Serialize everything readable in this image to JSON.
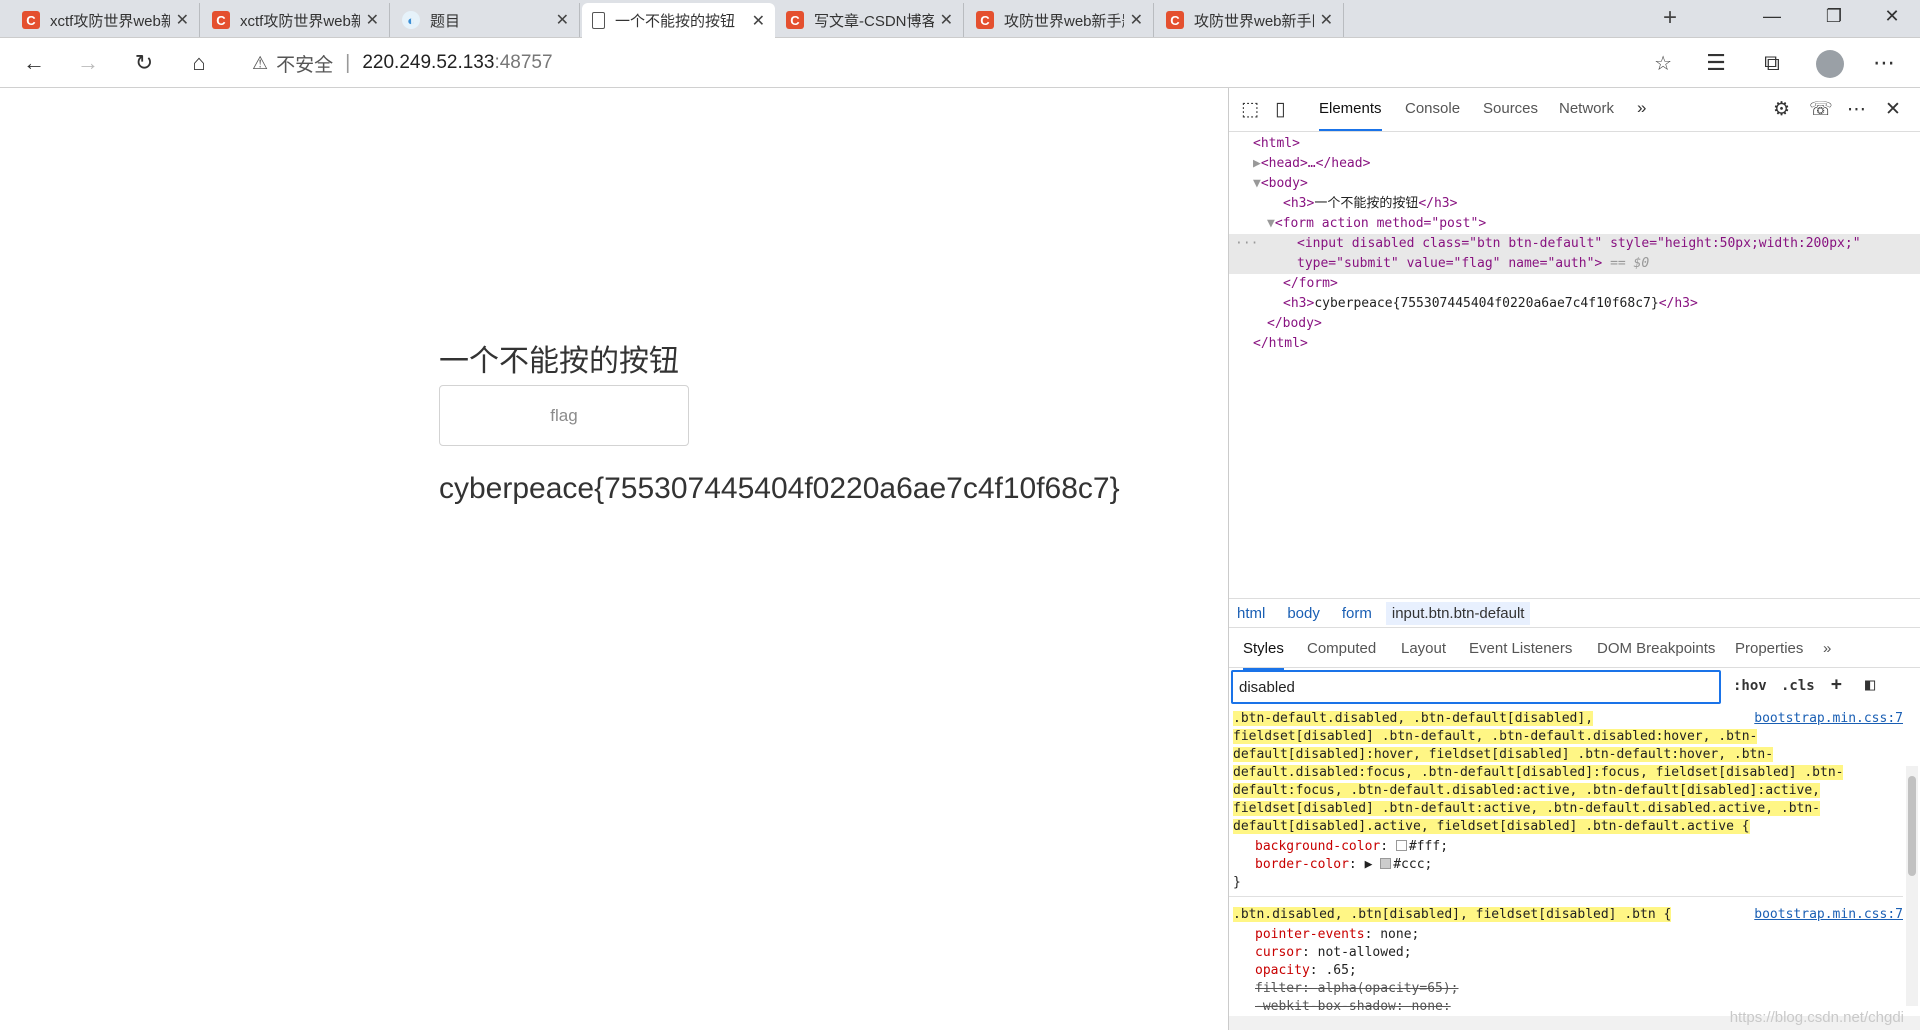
{
  "tabs": [
    {
      "title": "xctf攻防世界web新手练",
      "icon": "csdn-icon"
    },
    {
      "title": "xctf攻防世界web新手练",
      "icon": "csdn-icon"
    },
    {
      "title": "题目",
      "icon": "globe-icon"
    },
    {
      "title": "一个不能按的按钮",
      "icon": "page-icon"
    },
    {
      "title": "写文章-CSDN博客",
      "icon": "csdn-icon"
    },
    {
      "title": "攻防世界web新手题答",
      "icon": "csdn-icon"
    },
    {
      "title": "攻防世界web新手区题",
      "icon": "csdn-icon"
    }
  ],
  "address": {
    "security": "不安全",
    "host": "220.249.52.133",
    "port": ":48757"
  },
  "page": {
    "heading": "一个不能按的按钮",
    "button_label": "flag",
    "flag_text": "cyberpeace{755307445404f0220a6ae7c4f10f68c7}"
  },
  "devtools": {
    "tabs": [
      "Elements",
      "Console",
      "Sources",
      "Network"
    ],
    "dom": {
      "l_html_open": "<html>",
      "l_head": "<head>…</head>",
      "l_body_open": "<body>",
      "h3_text": "一个不能按的按钮",
      "l_form_open": "<form action method=\"post\">",
      "input_line1": "<input disabled class=\"btn btn-default\" style=\"height:50px;width:200px;\"",
      "input_line2": "type=\"submit\" value=\"flag\" name=\"auth\">",
      "dollar": "== $0",
      "l_form_close": "</form>",
      "h3_flag": "cyberpeace{755307445404f0220a6ae7c4f10f68c7}",
      "l_body_close": "</body>",
      "l_html_close": "</html>"
    },
    "breadcrumbs": [
      "html",
      "body",
      "form",
      "input.btn.btn-default"
    ],
    "subtabs": [
      "Styles",
      "Computed",
      "Layout",
      "Event Listeners",
      "DOM Breakpoints",
      "Properties"
    ],
    "filter_value": "disabled",
    "filter_tools": [
      ":hov",
      ".cls",
      "+"
    ],
    "rule1": {
      "selector_lines": [
        ".btn-default.disabled, .btn-default[disabled],",
        "fieldset[disabled] .btn-default, .btn-default.disabled:hover, .btn-",
        "default[disabled]:hover, fieldset[disabled] .btn-default:hover, .btn-",
        "default.disabled:focus, .btn-default[disabled]:focus, fieldset[disabled] .btn-",
        "default:focus, .btn-default.disabled:active, .btn-default[disabled]:active,",
        "fieldset[disabled] .btn-default:active, .btn-default.disabled.active, .btn-",
        "default[disabled].active, fieldset[disabled] .btn-default.active {"
      ],
      "source": "bootstrap.min.css:7",
      "props": [
        {
          "name": "background-color",
          "value": "#fff",
          "swatch": "#ffffff"
        },
        {
          "name": "border-color",
          "value": "#ccc",
          "swatch": "#cccccc"
        }
      ],
      "close": "}"
    },
    "rule2": {
      "selector": ".btn.disabled, .btn[disabled], fieldset[disabled] .btn {",
      "source": "bootstrap.min.css:7",
      "props": [
        {
          "name": "pointer-events",
          "value": "none;"
        },
        {
          "name": "cursor",
          "value": "not-allowed;"
        },
        {
          "name": "opacity",
          "value": ".65;"
        },
        {
          "name": "filter",
          "value": "alpha(opacity=65);"
        },
        {
          "name": "-webkit-box-shadow",
          "value": "none;"
        }
      ]
    },
    "watermark": "https://blog.csdn.net/chgdi"
  }
}
